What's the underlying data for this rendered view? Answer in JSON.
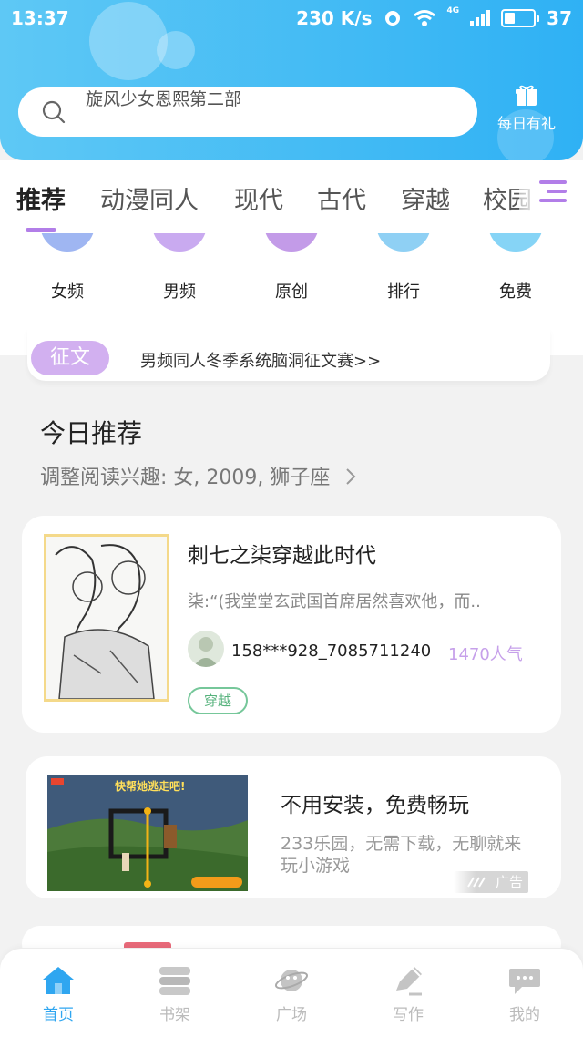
{
  "status": {
    "time": "13:37",
    "speed": "230 K/s",
    "network": "4G",
    "battery": "37",
    "battery_level": 0.37
  },
  "search": {
    "hint": "旋风少女恩熙第二部"
  },
  "daily": {
    "label": "每日有礼"
  },
  "tabs": [
    {
      "label": "推荐",
      "active": true
    },
    {
      "label": "动漫同人"
    },
    {
      "label": "现代"
    },
    {
      "label": "古代"
    },
    {
      "label": "穿越"
    },
    {
      "label": "校园"
    }
  ],
  "categories": [
    {
      "label": "女频",
      "color": "#9fb6f2"
    },
    {
      "label": "男频",
      "color": "#c9aaf0"
    },
    {
      "label": "原创",
      "color": "#c39be8"
    },
    {
      "label": "排行",
      "color": "#8fd0f4"
    },
    {
      "label": "免费",
      "color": "#86d4f6"
    }
  ],
  "contest": {
    "badge": "征文",
    "text": "男频同人冬季系统脑洞征文赛>>"
  },
  "today": {
    "title": "今日推荐",
    "subtitle": "调整阅读兴趣: 女, 2009, 狮子座"
  },
  "book": {
    "title": "刺七之柒穿越此时代",
    "desc": "柒:“(我堂堂玄武国首席居然喜欢他，而..",
    "author": "158***928_7085711240",
    "popularity": "1470人气",
    "tag": "穿越"
  },
  "ad": {
    "image_caption": "快帮她逃走吧!",
    "title": "不用安装，免费畅玩",
    "desc": "233乐园，无需下载，无聊就来玩小游戏",
    "label": "广告"
  },
  "nav": [
    {
      "label": "首页",
      "icon": "home-icon",
      "active": true
    },
    {
      "label": "书架",
      "icon": "bookshelf-icon"
    },
    {
      "label": "广场",
      "icon": "planet-icon"
    },
    {
      "label": "写作",
      "icon": "pen-icon"
    },
    {
      "label": "我的",
      "icon": "chat-icon"
    }
  ],
  "colors": {
    "accent": "#2fa6f0",
    "purple": "#b27ee8",
    "header": "#3db8f4"
  }
}
